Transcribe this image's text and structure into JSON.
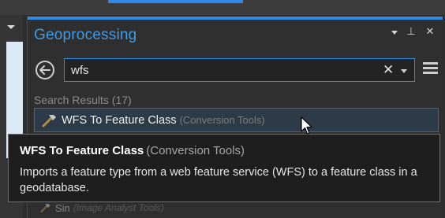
{
  "panel": {
    "title": "Geoprocessing",
    "controls": {
      "menu_icon": "chevron-down-icon",
      "pin_icon": "pin-icon",
      "pin_glyph": "⊥",
      "close_icon": "close-icon",
      "close_glyph": "✕"
    }
  },
  "search": {
    "value": "wfs",
    "placeholder": "",
    "clear_glyph": "✕"
  },
  "results": {
    "label": "Search Results (17)",
    "items": [
      {
        "name": "WFS To Feature Class",
        "category": "(Conversion Tools)",
        "icon": "hammer-icon",
        "selected": true
      },
      {
        "name": "Sin",
        "category": "(Image Analyst Tools)",
        "icon": "hammer-icon",
        "selected": false
      }
    ]
  },
  "tooltip": {
    "title": "WFS To Feature Class",
    "category": "(Conversion Tools)",
    "description": "Imports a feature type from a web feature service (WFS) to a feature class in a geodatabase."
  },
  "colors": {
    "accent": "#2e8ae6",
    "title": "#3e9be8",
    "background": "#2f2f2f",
    "selected_row": "#2d3a48"
  }
}
